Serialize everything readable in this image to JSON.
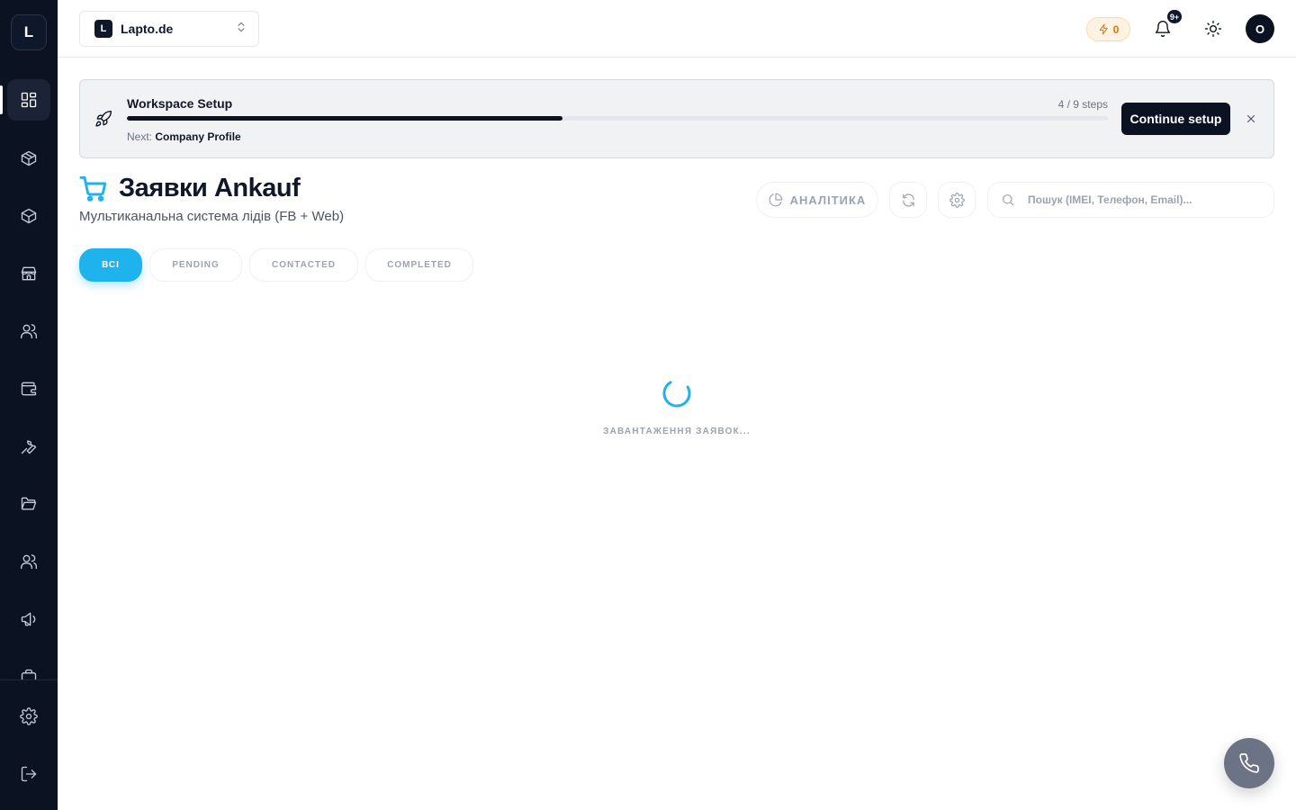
{
  "sidebar": {
    "logo_letter": "L",
    "items": [
      {
        "icon": "dashboard-icon",
        "active": true
      },
      {
        "icon": "package-icon"
      },
      {
        "icon": "box-icon"
      },
      {
        "icon": "store-icon"
      },
      {
        "icon": "users-icon"
      },
      {
        "icon": "wallet-icon"
      },
      {
        "icon": "wrench-icon"
      },
      {
        "icon": "folder-icon"
      },
      {
        "icon": "team-icon"
      },
      {
        "icon": "megaphone-icon"
      },
      {
        "icon": "briefcase-icon"
      }
    ],
    "bottom": [
      {
        "icon": "settings-icon"
      },
      {
        "icon": "logout-icon"
      }
    ]
  },
  "topbar": {
    "workspace_badge": "L",
    "workspace_name": "Lapto.de",
    "credits": "0",
    "notifications_badge": "9+",
    "avatar_initial": "O"
  },
  "setup": {
    "title": "Workspace Setup",
    "steps_text": "4 / 9 steps",
    "progress": 0.444,
    "next_label": "Next:",
    "next_value": "Company Profile",
    "button": "Continue setup"
  },
  "page": {
    "title": "Заявки Ankauf",
    "subtitle": "Мультиканальна система лідів (FB + Web)",
    "analytics_label": "АНАЛІТИКА",
    "search_placeholder": "Пошук (IMEI, Телефон, Email)..."
  },
  "tabs": [
    {
      "label": "ВСІ",
      "active": true
    },
    {
      "label": "PENDING"
    },
    {
      "label": "CONTACTED"
    },
    {
      "label": "COMPLETED"
    }
  ],
  "loading_text": "ЗАВАНТАЖЕННЯ ЗАЯВОК...",
  "colors": {
    "accent": "#1fb3ee",
    "sidebar_bg": "#0b1222",
    "credits": "#d97706"
  }
}
